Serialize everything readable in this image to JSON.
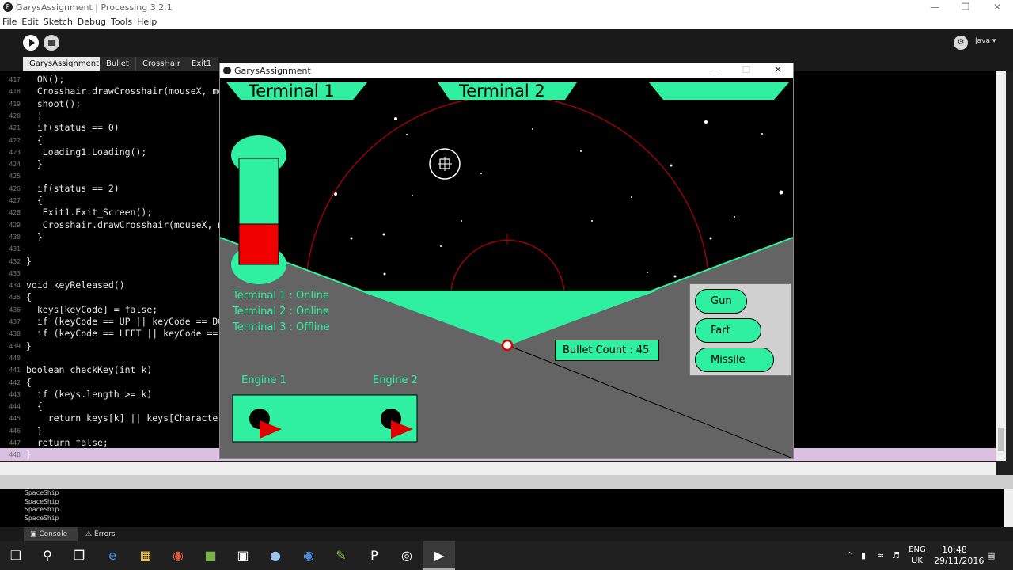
{
  "ide": {
    "window_title": "GarysAssignment | Processing 3.2.1",
    "menu": [
      "File",
      "Edit",
      "Sketch",
      "Debug",
      "Tools",
      "Help"
    ],
    "mode": "Java ▾",
    "tabs": [
      "GarysAssignment",
      "Bullet",
      "CrossHair",
      "Exit1"
    ],
    "code_lines": [
      {
        "n": "417",
        "text": "  ON();"
      },
      {
        "n": "418",
        "text": "  Crosshair.drawCrosshair(mouseX, mouseY);"
      },
      {
        "n": "419",
        "text": "  shoot();"
      },
      {
        "n": "420",
        "text": "  }"
      },
      {
        "n": "421",
        "text": "  if(status == 0)"
      },
      {
        "n": "422",
        "text": "  {"
      },
      {
        "n": "423",
        "text": "   Loading1.Loading();"
      },
      {
        "n": "424",
        "text": "  }"
      },
      {
        "n": "425",
        "text": ""
      },
      {
        "n": "426",
        "text": "  if(status == 2)"
      },
      {
        "n": "427",
        "text": "  {"
      },
      {
        "n": "428",
        "text": "   Exit1.Exit_Screen();"
      },
      {
        "n": "429",
        "text": "   Crosshair.drawCrosshair(mouseX, mouseY);"
      },
      {
        "n": "430",
        "text": "  }"
      },
      {
        "n": "431",
        "text": ""
      },
      {
        "n": "432",
        "text": "}"
      },
      {
        "n": "433",
        "text": ""
      },
      {
        "n": "434",
        "text": "void keyReleased()"
      },
      {
        "n": "435",
        "text": "{"
      },
      {
        "n": "436",
        "text": "  keys[keyCode] = false;"
      },
      {
        "n": "437",
        "text": "  if (keyCode == UP || keyCode == DOWN)"
      },
      {
        "n": "438",
        "text": "  if (keyCode == LEFT || keyCode == RIGHT)"
      },
      {
        "n": "439",
        "text": "}"
      },
      {
        "n": "440",
        "text": ""
      },
      {
        "n": "441",
        "text": "boolean checkKey(int k)"
      },
      {
        "n": "442",
        "text": "{"
      },
      {
        "n": "443",
        "text": "  if (keys.length >= k)"
      },
      {
        "n": "444",
        "text": "  {"
      },
      {
        "n": "445",
        "text": "    return keys[k] || keys[Character.toUpperCase(k)];"
      },
      {
        "n": "446",
        "text": "  }"
      },
      {
        "n": "447",
        "text": "  return false;"
      },
      {
        "n": "448",
        "text": "}"
      }
    ],
    "console_lines": [
      "SpaceShip",
      "SpaceShip",
      "SpaceShip",
      "SpaceShip"
    ],
    "footer_tabs": [
      "Console",
      "Errors"
    ]
  },
  "sketch": {
    "window_title": "GarysAssignment",
    "terminals": [
      "Terminal 1",
      "Terminal 2",
      ""
    ],
    "status_lines": [
      "Terminal 1 : Online",
      "Terminal 2 : Online",
      "Terminal 3 : Offline"
    ],
    "engines": [
      "Engine 1",
      "Engine 2"
    ],
    "bullet_count": "Bullet Count : 45",
    "weapons": [
      "Gun",
      "Fart",
      "Missile"
    ],
    "colors": {
      "accent": "#2ef0a0",
      "hull": "#646464",
      "alert": "#ff0000",
      "space": "#000000"
    }
  },
  "taskbar": {
    "lang": "ENG",
    "region": "UK",
    "time": "10:48",
    "date": "29/11/2016"
  }
}
